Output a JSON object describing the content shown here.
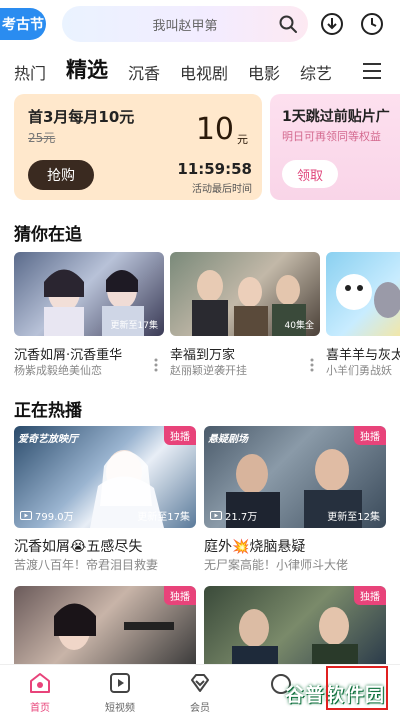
{
  "topbar": {
    "logo_text": "考古节",
    "search_placeholder": "我叫赵甲第",
    "icons": [
      "search-icon",
      "download-icon",
      "history-icon"
    ]
  },
  "tabs": [
    {
      "label": "热门",
      "active": false
    },
    {
      "label": "精选",
      "active": true
    },
    {
      "label": "沉香",
      "active": false
    },
    {
      "label": "电视剧",
      "active": false
    },
    {
      "label": "电影",
      "active": false
    },
    {
      "label": "综艺",
      "active": false
    }
  ],
  "promo": {
    "card1": {
      "title": "首3月每月10元",
      "old_price": "25元",
      "price": "10",
      "price_unit": "元",
      "button": "抢购",
      "countdown": "11:59:58",
      "countdown_label": "活动最后时间"
    },
    "card2": {
      "title": "1天跳过前贴片广",
      "subtitle": "明日可再领同等权益",
      "button": "领取"
    }
  },
  "section_following": {
    "title": "猜你在追",
    "items": [
      {
        "title": "沉香如屑·沉香重华",
        "sub": "杨紫成毅绝美仙恋",
        "badge": "更新至17集"
      },
      {
        "title": "幸福到万家",
        "sub": "赵丽颖逆袭开挂",
        "badge": "40集全"
      },
      {
        "title": "喜羊羊与灰太",
        "sub": "小羊们勇战妖",
        "badge": ""
      }
    ]
  },
  "section_hot": {
    "title": "正在热播",
    "items": [
      {
        "title": "沉香如屑😭五感尽失",
        "sub": "苦渡八百年！帝君泪目救妻",
        "exclusive": "独播",
        "brand": "爱奇艺放映厅",
        "plays": "799.0万",
        "ep": "更新至17集"
      },
      {
        "title": "庭外💥烧脑悬疑",
        "sub": "无尸案高能！小律师斗大佬",
        "exclusive": "独播",
        "brand": "悬疑剧场",
        "plays": "21.7万",
        "ep": "更新至12集"
      },
      {
        "title": "",
        "sub": "",
        "exclusive": "独播",
        "brand": "",
        "plays": "",
        "ep": ""
      },
      {
        "title": "",
        "sub": "",
        "exclusive": "独播",
        "brand": "",
        "plays": "",
        "ep": ""
      }
    ]
  },
  "bottom_nav": [
    {
      "label": "首页",
      "icon": "home-icon",
      "active": true
    },
    {
      "label": "短视频",
      "icon": "short-video-icon",
      "active": false
    },
    {
      "label": "会员",
      "icon": "vip-icon",
      "active": false
    }
  ],
  "watermark": "谷普软件园",
  "colors": {
    "accent": "#e8437a",
    "logo_blue": "#2a8cf0",
    "promo1_bg": "#ffe8cc",
    "promo2_bg": "#fde0ef"
  }
}
